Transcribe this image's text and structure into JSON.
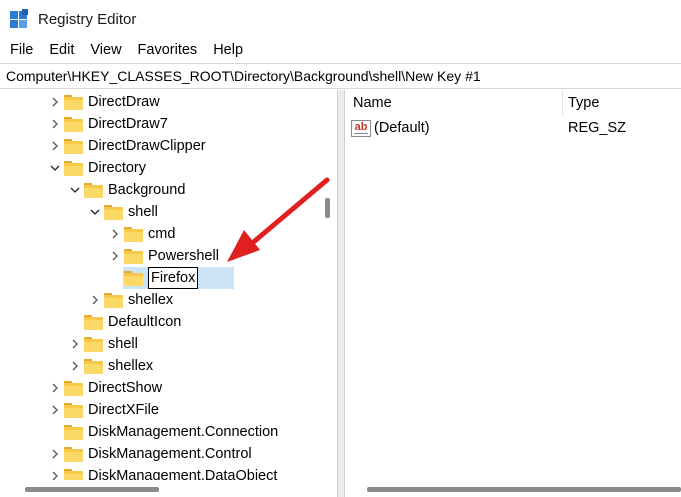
{
  "window": {
    "title": "Registry Editor",
    "app_icon": "registry-editor-icon"
  },
  "menu": [
    "File",
    "Edit",
    "View",
    "Favorites",
    "Help"
  ],
  "address": "Computer\\HKEY_CLASSES_ROOT\\Directory\\Background\\shell\\New Key #1",
  "tree": {
    "items": [
      {
        "label": "DirectDraw",
        "chevron": "right"
      },
      {
        "label": "DirectDraw7",
        "chevron": "right"
      },
      {
        "label": "DirectDrawClipper",
        "chevron": "right"
      },
      {
        "label": "Directory",
        "chevron": "down"
      },
      {
        "label": "Background",
        "chevron": "down"
      },
      {
        "label": "shell",
        "chevron": "down"
      },
      {
        "label": "cmd",
        "chevron": "right"
      },
      {
        "label": "Powershell",
        "chevron": "right"
      },
      {
        "label": "Firefox",
        "chevron": "none"
      },
      {
        "label": "shellex",
        "chevron": "right"
      },
      {
        "label": "DefaultIcon",
        "chevron": "none"
      },
      {
        "label": "shell",
        "chevron": "right"
      },
      {
        "label": "shellex",
        "chevron": "right"
      },
      {
        "label": "DirectShow",
        "chevron": "right"
      },
      {
        "label": "DirectXFile",
        "chevron": "right"
      },
      {
        "label": "DiskManagement.Connection",
        "chevron": "none"
      },
      {
        "label": "DiskManagement.Control",
        "chevron": "right"
      },
      {
        "label": "DiskManagement.DataObject",
        "chevron": "right"
      }
    ],
    "rename_value": "Firefox"
  },
  "list": {
    "columns": [
      "Name",
      "Type"
    ],
    "rows": [
      {
        "name": "(Default)",
        "type": "REG_SZ",
        "icon": "string-value-icon"
      }
    ]
  },
  "colors": {
    "arrow": "#e02020",
    "selection": "#cce4f7",
    "folder": "#f7c84a"
  }
}
